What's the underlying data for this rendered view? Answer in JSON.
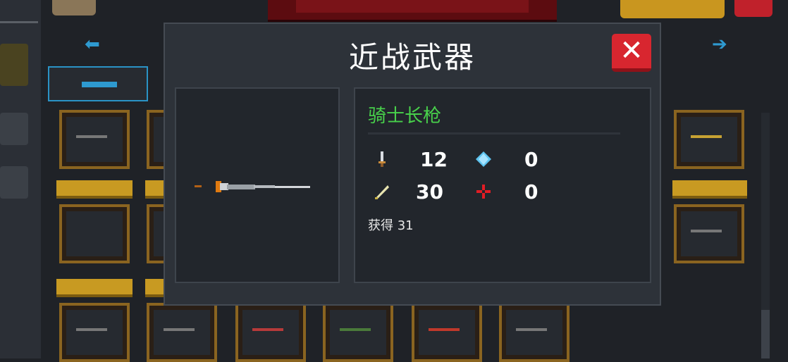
{
  "dialog": {
    "title": "近战武器",
    "close_icon": "close-icon",
    "weapon": {
      "name": "骑士长枪",
      "name_color": "#48d14b",
      "stats": [
        {
          "icon": "sword-icon",
          "value": "12"
        },
        {
          "icon": "crystal-icon",
          "value": "0"
        },
        {
          "icon": "feather-icon",
          "value": "30"
        },
        {
          "icon": "crosshair-icon",
          "value": "0"
        }
      ],
      "acquired_label": "获得",
      "acquired_value": "31"
    }
  },
  "colors": {
    "dialog_bg": "#2d3239",
    "close_button": "#d8262f",
    "accent_blue": "#2e9ad0",
    "shelf_gold": "#c89a22"
  }
}
